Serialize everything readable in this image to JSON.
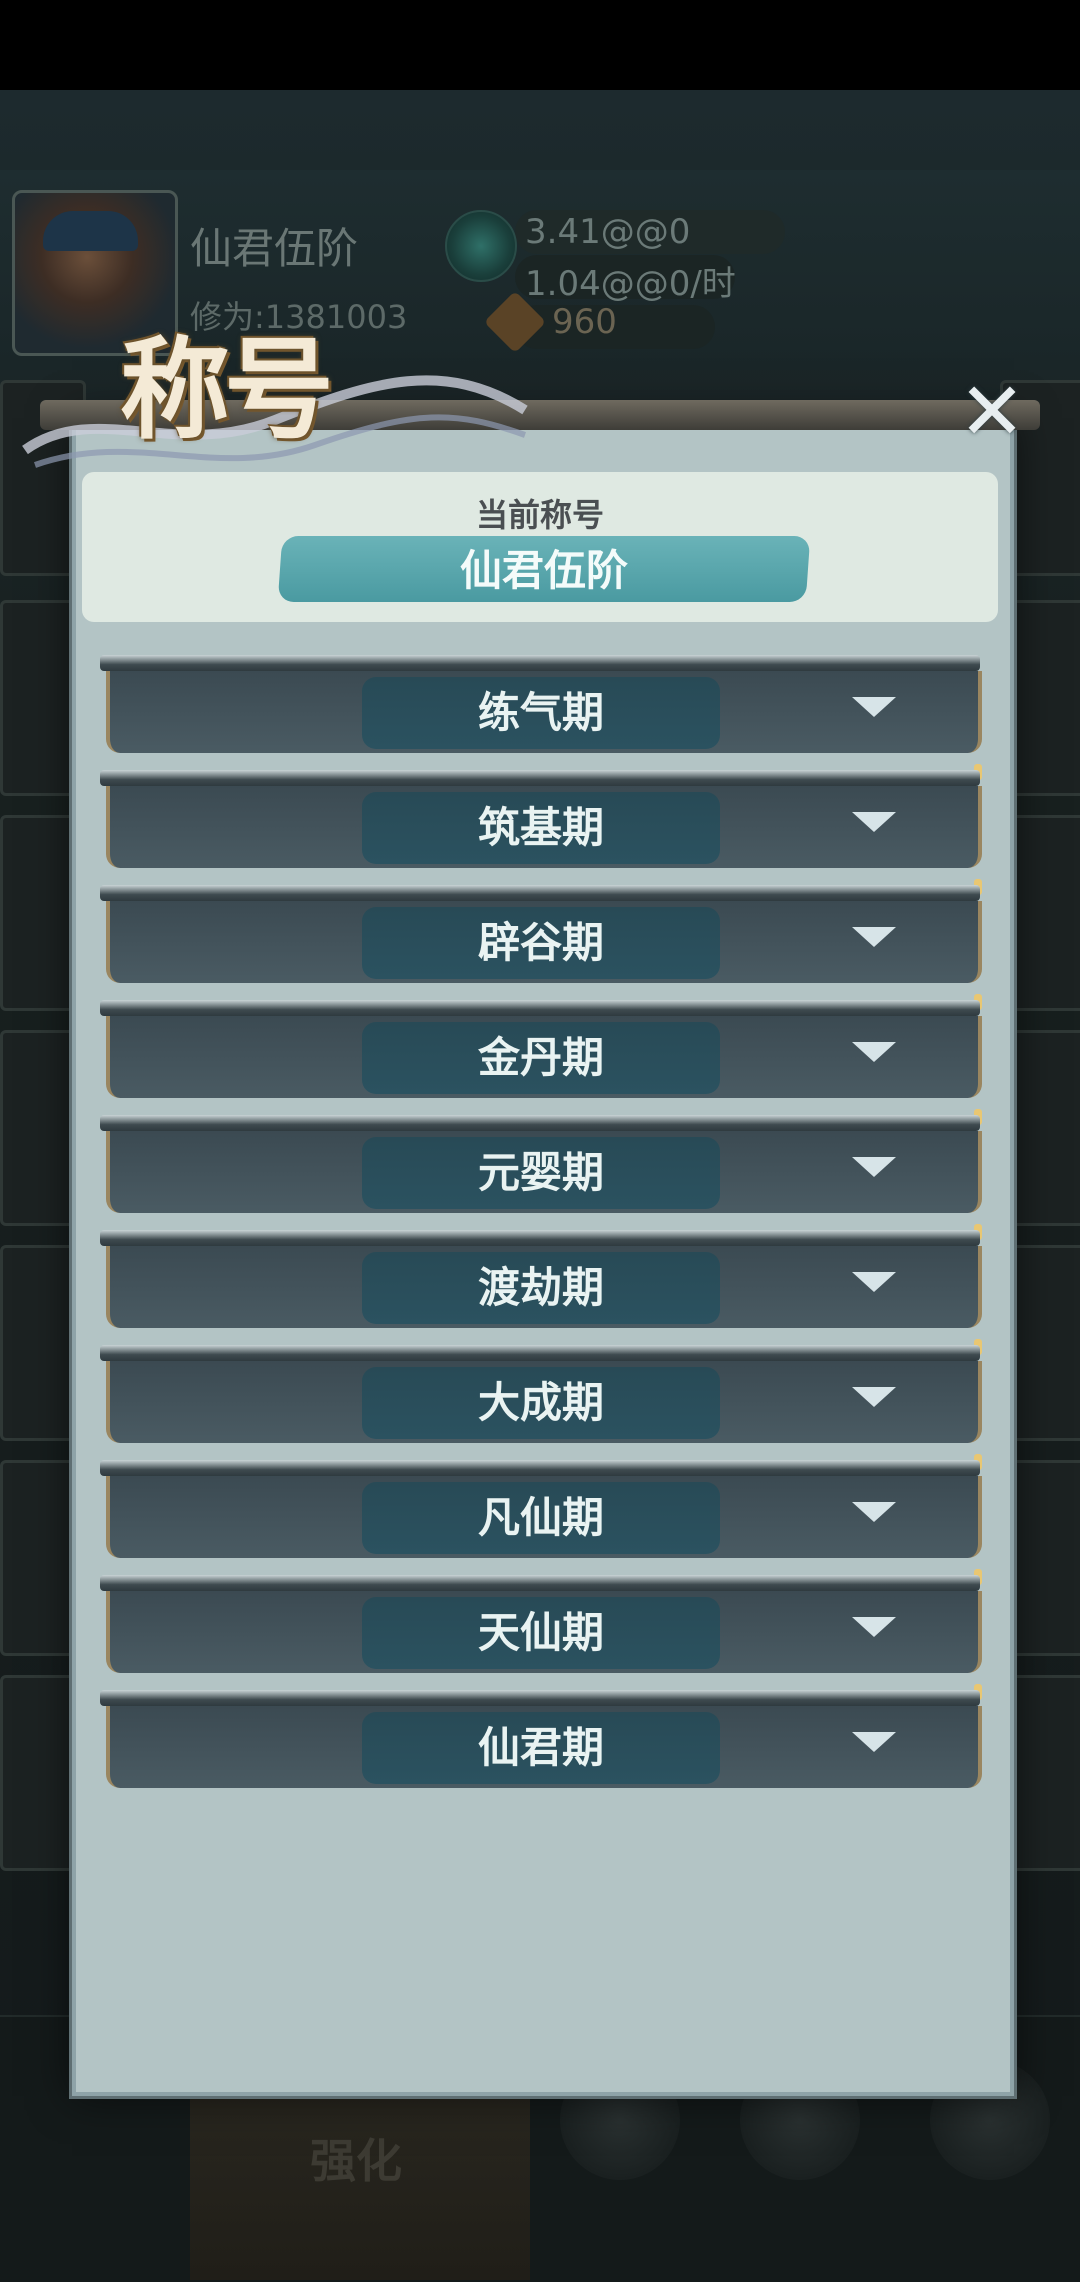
{
  "background": {
    "player_name": "仙君伍阶",
    "power_text": "修为:1381003",
    "resource_total": "3.41@@0",
    "resource_rate": "1.04@@0/时",
    "gems": "960",
    "bottom_nav_label": "强化"
  },
  "dialog": {
    "title": "称号",
    "close_symbol": "✕",
    "current_label": "当前称号",
    "current_title": "仙君伍阶",
    "stages": [
      {
        "label": "练气期"
      },
      {
        "label": "筑基期"
      },
      {
        "label": "辟谷期"
      },
      {
        "label": "金丹期"
      },
      {
        "label": "元婴期"
      },
      {
        "label": "渡劫期"
      },
      {
        "label": "大成期"
      },
      {
        "label": "凡仙期"
      },
      {
        "label": "天仙期"
      },
      {
        "label": "仙君期"
      }
    ]
  },
  "colors": {
    "dialog_bg": "#b3c4c5",
    "pill": "#4a9aa1",
    "row_body": "#3b4a52"
  }
}
